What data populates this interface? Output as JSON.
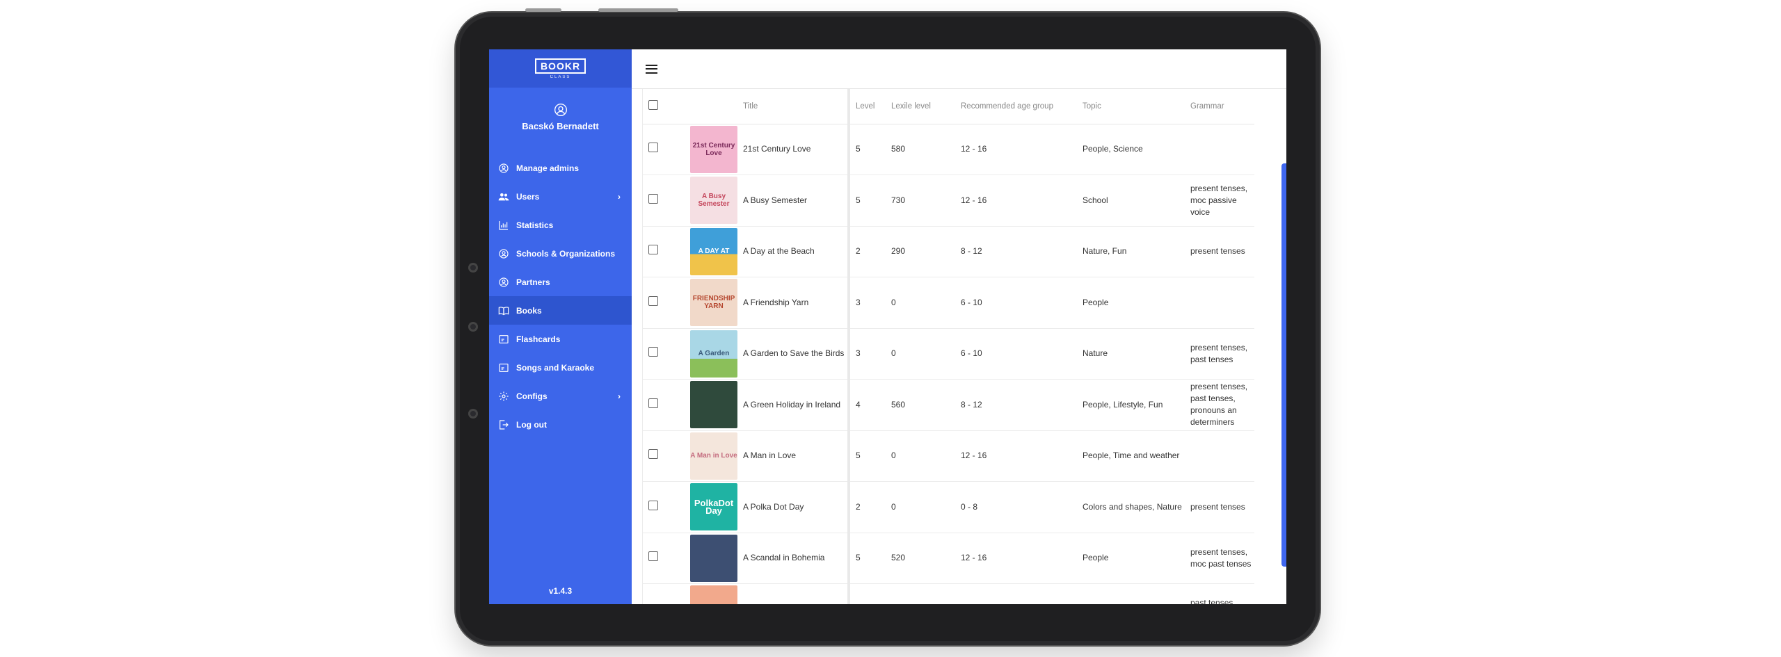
{
  "app": {
    "brand": "BOOKR",
    "brand_sub": "CLASS",
    "user_name": "Bacskó Bernadett",
    "version": "v1.4.3"
  },
  "sidebar": {
    "items": [
      {
        "label": "Manage admins",
        "icon": "admin-icon",
        "active": false,
        "chevron": false
      },
      {
        "label": "Users",
        "icon": "users-icon",
        "active": false,
        "chevron": true
      },
      {
        "label": "Statistics",
        "icon": "chart-icon",
        "active": false,
        "chevron": false
      },
      {
        "label": "Schools & Organizations",
        "icon": "school-icon",
        "active": false,
        "chevron": false
      },
      {
        "label": "Partners",
        "icon": "partner-icon",
        "active": false,
        "chevron": false
      },
      {
        "label": "Books",
        "icon": "book-icon",
        "active": true,
        "chevron": false
      },
      {
        "label": "Flashcards",
        "icon": "flashcard-icon",
        "active": false,
        "chevron": false
      },
      {
        "label": "Songs and Karaoke",
        "icon": "music-icon",
        "active": false,
        "chevron": false
      },
      {
        "label": "Configs",
        "icon": "gear-icon",
        "active": false,
        "chevron": true
      },
      {
        "label": "Log out",
        "icon": "logout-icon",
        "active": false,
        "chevron": false
      }
    ]
  },
  "table": {
    "headers": {
      "title": "Title",
      "level": "Level",
      "lexile": "Lexile level",
      "age": "Recommended age group",
      "topic": "Topic",
      "grammar": "Grammar"
    },
    "rows": [
      {
        "title": "21st Century Love",
        "level": "5",
        "lexile": "580",
        "age": "12 - 16",
        "topic": "People, Science",
        "grammar": "",
        "cover_text": "21st Century Love",
        "cover_color": "#f3b6cf"
      },
      {
        "title": "A Busy Semester",
        "level": "5",
        "lexile": "730",
        "age": "12 - 16",
        "topic": "School",
        "grammar": "present tenses, moc passive voice",
        "cover_text": "A Busy Semester",
        "cover_color": "#e77a8a"
      },
      {
        "title": "A Day at the Beach",
        "level": "2",
        "lexile": "290",
        "age": "8 - 12",
        "topic": "Nature, Fun",
        "grammar": "present tenses",
        "cover_text": "A DAY AT",
        "cover_color": "#3f9fd9"
      },
      {
        "title": "A Friendship Yarn",
        "level": "3",
        "lexile": "0",
        "age": "6 - 10",
        "topic": "People",
        "grammar": "",
        "cover_text": "FRIENDSHIP YARN",
        "cover_color": "#f1d9c9"
      },
      {
        "title": "A Garden to Save the Birds",
        "level": "3",
        "lexile": "0",
        "age": "6 - 10",
        "topic": "Nature",
        "grammar": "present tenses, past tenses",
        "cover_text": "A Garden",
        "cover_color": "#a9d7e6"
      },
      {
        "title": "A Green Holiday in Ireland",
        "level": "4",
        "lexile": "560",
        "age": "8 - 12",
        "topic": "People, Lifestyle, Fun",
        "grammar": "present tenses, past tenses, pronouns an determiners",
        "cover_text": "",
        "cover_color": "#2f4a3c"
      },
      {
        "title": "A Man in Love",
        "level": "5",
        "lexile": "0",
        "age": "12 - 16",
        "topic": "People, Time and weather",
        "grammar": "",
        "cover_text": "A Man in Love",
        "cover_color": "#f4e6dc"
      },
      {
        "title": "A Polka Dot Day",
        "level": "2",
        "lexile": "0",
        "age": "0 - 8",
        "topic": "Colors and shapes, Nature",
        "grammar": "present tenses",
        "cover_text": "PolkaDot Day",
        "cover_color": "#1fb3a3"
      },
      {
        "title": "A Scandal in Bohemia",
        "level": "5",
        "lexile": "520",
        "age": "12 - 16",
        "topic": "People",
        "grammar": "present tenses, moc past tenses",
        "cover_text": "",
        "cover_color": "#3d4f72"
      },
      {
        "title": "",
        "level": "",
        "lexile": "",
        "age": "",
        "topic": "",
        "grammar": "past tenses, perfect",
        "cover_text": "",
        "cover_color": "#f2a98c"
      }
    ]
  },
  "colors": {
    "sidebar": "#3d66ea",
    "sidebar_active": "#2e55cf",
    "highlight": "#3f67f0"
  }
}
